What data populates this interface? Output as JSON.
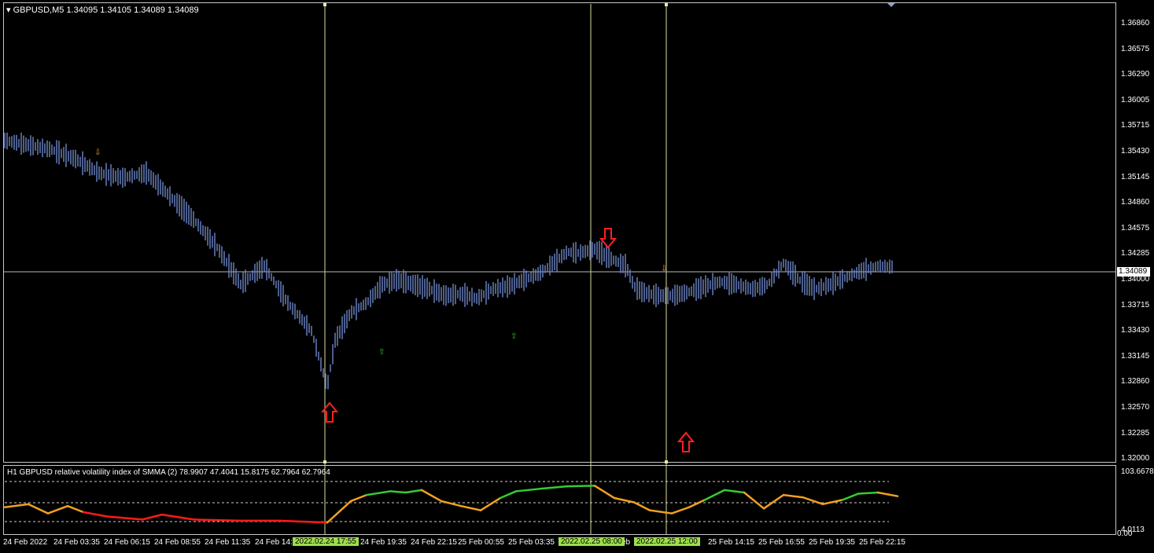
{
  "chart": {
    "symbol_line": "GBPUSD,M5  1.34095 1.34105 1.34089 1.34089",
    "current_price": "1.34089",
    "colors": {
      "background": "#000000",
      "candles": "#6e86c8",
      "crosshair": "#dcdca0",
      "up_arrow": "#ff2020",
      "down_arrow": "#ff2020"
    },
    "price_axis": [
      "1.36860",
      "1.36575",
      "1.36290",
      "1.36005",
      "1.35715",
      "1.35430",
      "1.35145",
      "1.34860",
      "1.34575",
      "1.34285",
      "1.34000",
      "1.33715",
      "1.33430",
      "1.33145",
      "1.32860",
      "1.32570",
      "1.32285",
      "1.32000"
    ],
    "ylim": [
      1.32,
      1.3686
    ]
  },
  "indicator": {
    "title": "H1 GBPUSD relative volatility index of SMMA (2) 78.9907 47.4041 15.8175 62.7964 62.7964",
    "axis_top": "103.6678",
    "axis_mid": "4.0113",
    "axis_bottom": "0.00",
    "colors": {
      "rising": "#33cc33",
      "falling": "#ff1a1a",
      "neutral": "#f0a020",
      "levels": "#cccccc"
    }
  },
  "time_axis": {
    "labels": [
      "24 Feb 2022",
      "24 Feb 03:35",
      "24 Feb 06:15",
      "24 Feb 08:55",
      "24 Feb 11:35",
      "24 Feb 14:1",
      "24 Feb 19:35",
      "24 Feb 22:15",
      "25 Feb 00:55",
      "25 Feb 03:35",
      "eb",
      "25 Feb 14:15",
      "25 Feb 16:55",
      "25 Feb 19:35",
      "25 Feb 22:15"
    ],
    "highlighted": [
      "2022.02.24 17:55",
      "2022.02.25 08:00",
      "2022.02.25 12:00"
    ]
  },
  "chart_data": {
    "type": "line",
    "title": "GBPUSD,M5",
    "series": [
      {
        "name": "GBPUSD,M5",
        "x": [
          0,
          30,
          60,
          90,
          120,
          150,
          180,
          210,
          240,
          270,
          300,
          330,
          360,
          390,
          410,
          420,
          440,
          460,
          480,
          500,
          520,
          540,
          560,
          580,
          600,
          620,
          640,
          660,
          680,
          700,
          715,
          730,
          750,
          770,
          790,
          800,
          810,
          830,
          850,
          870,
          890,
          910,
          930,
          950,
          970,
          990,
          1010,
          1030,
          1050,
          1070,
          1090,
          1110,
          1130
        ],
        "values": [
          1.3545,
          1.354,
          1.3535,
          1.3525,
          1.351,
          1.3505,
          1.351,
          1.3485,
          1.346,
          1.343,
          1.339,
          1.341,
          1.337,
          1.334,
          1.328,
          1.333,
          1.336,
          1.337,
          1.339,
          1.3395,
          1.339,
          1.3385,
          1.3378,
          1.338,
          1.3375,
          1.3385,
          1.3388,
          1.3395,
          1.3402,
          1.3415,
          1.3425,
          1.3424,
          1.3428,
          1.3418,
          1.341,
          1.3388,
          1.3382,
          1.3378,
          1.3378,
          1.3382,
          1.3388,
          1.3393,
          1.339,
          1.3385,
          1.339,
          1.3413,
          1.3395,
          1.3385,
          1.339,
          1.3398,
          1.3405,
          1.341,
          1.3409
        ]
      },
      {
        "name": "relative volatility index of SMMA (2)",
        "x": [
          0,
          30,
          55,
          80,
          100,
          130,
          175,
          200,
          240,
          300,
          350,
          410,
          440,
          460,
          490,
          510,
          530,
          555,
          580,
          605,
          630,
          650,
          680,
          715,
          750,
          775,
          800,
          820,
          848,
          870,
          890,
          915,
          940,
          965,
          990,
          1015,
          1040,
          1065,
          1085,
          1110,
          1135
        ],
        "values": [
          40,
          45,
          30,
          42,
          32,
          25,
          20,
          28,
          20,
          18,
          18,
          15,
          50,
          60,
          66,
          64,
          68,
          50,
          42,
          35,
          55,
          66,
          70,
          74,
          75,
          55,
          48,
          35,
          30,
          40,
          52,
          68,
          64,
          38,
          60,
          56,
          45,
          52,
          62,
          64,
          58
        ]
      }
    ]
  }
}
